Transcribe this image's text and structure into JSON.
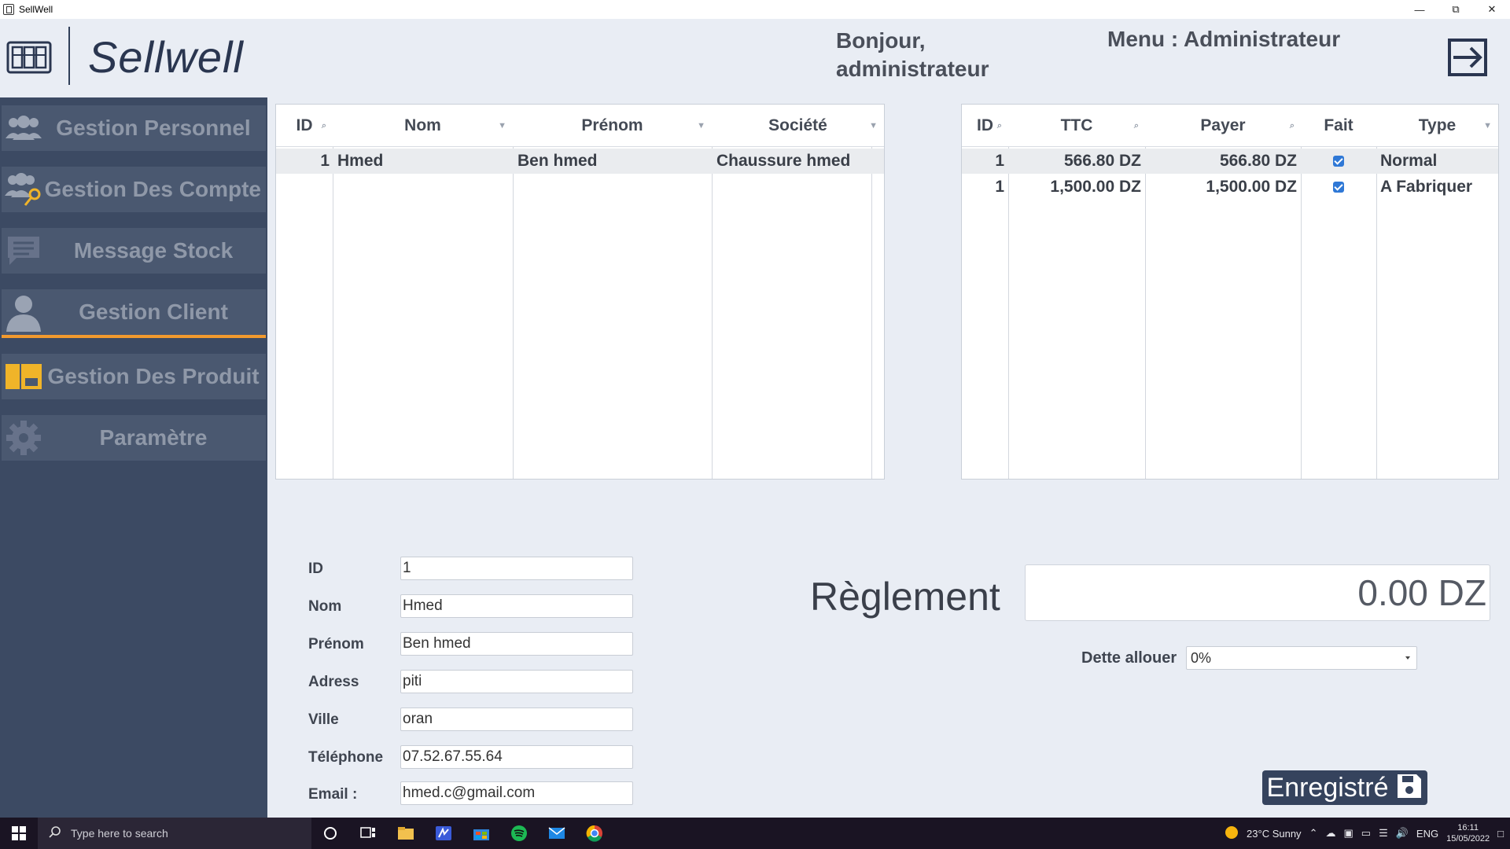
{
  "window": {
    "title": "SellWell"
  },
  "header": {
    "brand": "Sellwell",
    "greeting_line1": "Bonjour,",
    "greeting_line2": "administrateur",
    "menu_title": "Menu : Administrateur"
  },
  "sidebar": {
    "items": [
      {
        "label": "Gestion Personnel",
        "icon": "users-icon",
        "active": false
      },
      {
        "label": "Gestion Des Compte",
        "icon": "users-key-icon",
        "active": false
      },
      {
        "label": "Message Stock",
        "icon": "message-icon",
        "active": false
      },
      {
        "label": "Gestion Client",
        "icon": "person-icon",
        "active": true
      },
      {
        "label": "Gestion Des Produit",
        "icon": "products-icon",
        "active": false
      },
      {
        "label": "Paramètre",
        "icon": "gear-icon",
        "active": false
      }
    ],
    "accent_color": "#f29a2e"
  },
  "clients_table": {
    "columns": [
      "ID",
      "Nom",
      "Prénom",
      "Société"
    ],
    "rows": [
      {
        "id": "1",
        "nom": "Hmed",
        "prenom": "Ben hmed",
        "societe": "Chaussure hmed"
      }
    ]
  },
  "orders_table": {
    "columns": [
      "ID",
      "TTC",
      "Payer",
      "Fait",
      "Type"
    ],
    "rows": [
      {
        "id": "1",
        "ttc": "566.80 DZ",
        "payer": "566.80 DZ",
        "fait": true,
        "type": "Normal"
      },
      {
        "id": "1",
        "ttc": "1,500.00 DZ",
        "payer": "1,500.00 DZ",
        "fait": true,
        "type": "A Fabriquer"
      }
    ]
  },
  "form": {
    "id_label": "ID",
    "id_value": "1",
    "nom_label": "Nom",
    "nom_value": "Hmed",
    "prenom_label": "Prénom",
    "prenom_value": "Ben hmed",
    "adress_label": "Adress",
    "adress_value": "piti",
    "ville_label": "Ville",
    "ville_value": "oran",
    "telephone_label": "Téléphone",
    "telephone_value": "07.52.67.55.64",
    "email_label": "Email :",
    "email_value": "hmed.c@gmail.com"
  },
  "reglement": {
    "label": "Règlement",
    "amount": "0.00 DZ",
    "dette_label": "Dette allouer",
    "dette_value": "0%"
  },
  "save_button": {
    "label": "Enregistré"
  },
  "taskbar": {
    "search_placeholder": "Type here to search",
    "weather": "23°C  Sunny",
    "lang": "ENG",
    "time": "16:11",
    "date": "15/05/2022"
  }
}
